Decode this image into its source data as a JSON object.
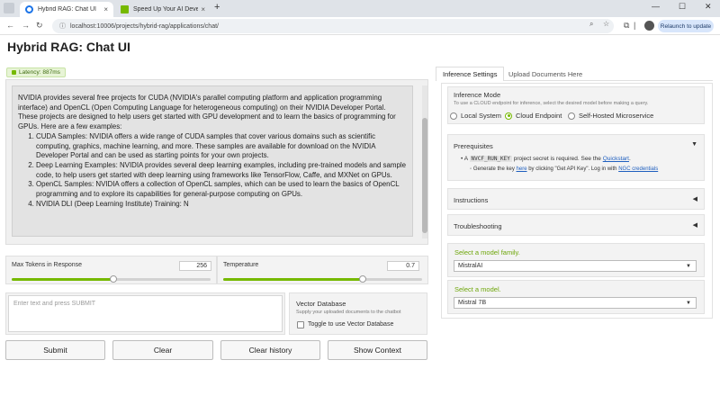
{
  "browser": {
    "tabs": [
      {
        "title": "Hybrid RAG: Chat UI",
        "close": "×"
      },
      {
        "title": "Speed Up Your AI Development",
        "close": "×"
      }
    ],
    "new_tab": "+",
    "window_controls": {
      "minimize": "—",
      "maximize": "☐",
      "close": "✕"
    },
    "url": "localhost:10006/projects/hybrid-rag/applications/chat/",
    "relaunch_label": "Relaunch to update"
  },
  "app": {
    "title": "Hybrid RAG: Chat UI",
    "latency": "Latency: 887ms",
    "chat": {
      "intro": "NVIDIA provides several free projects for CUDA (NVIDIA's parallel computing platform and application programming interface) and OpenCL (Open Computing Language for heterogeneous computing) on their NVIDIA Developer Portal. These projects are designed to help users get started with GPU development and to learn the basics of programming for GPUs. Here are a few examples:",
      "items": [
        "CUDA Samples: NVIDIA offers a wide range of CUDA samples that cover various domains such as scientific computing, graphics, machine learning, and more. These samples are available for download on the NVIDIA Developer Portal and can be used as starting points for your own projects.",
        "Deep Learning Examples: NVIDIA provides several deep learning examples, including pre-trained models and sample code, to help users get started with deep learning using frameworks like TensorFlow, Caffe, and MXNet on GPUs.",
        "OpenCL Samples: NVIDIA offers a collection of OpenCL samples, which can be used to learn the basics of OpenCL programming and to explore its capabilities for general-purpose computing on GPUs.",
        "NVIDIA DLI (Deep Learning Institute) Training: N"
      ]
    },
    "max_tokens": {
      "label": "Max Tokens in Response",
      "value": "256",
      "fraction": 0.51
    },
    "temperature": {
      "label": "Temperature",
      "value": "0.7",
      "fraction": 0.7
    },
    "input_placeholder": "Enter text and press SUBMIT",
    "vector_db": {
      "title": "Vector Database",
      "desc": "Supply your uploaded documents to the chatbot",
      "toggle_label": "Toggle to use Vector Database"
    },
    "buttons": {
      "submit": "Submit",
      "clear": "Clear",
      "clear_history": "Clear history",
      "show_context": "Show Context"
    }
  },
  "settings": {
    "tabs": [
      "Inference Settings",
      "Upload Documents Here"
    ],
    "inference_mode": {
      "title": "Inference Mode",
      "desc": "To use a CLOUD endpoint for inference, select the desired model before making a query.",
      "options": [
        "Local System",
        "Cloud Endpoint",
        "Self-Hosted Microservice"
      ],
      "selected": "Cloud Endpoint"
    },
    "prerequisites": {
      "title": "Prerequisites",
      "line1_pre": "A",
      "line1_code": "NVCF_RUN_KEY",
      "line1_mid": "project secret is required. See the",
      "line1_link": "Quickstart",
      "line1_post": ".",
      "line2_pre": "Generate the key",
      "line2_link1": "here",
      "line2_mid": "by clicking \"Get API Key\". Log in with",
      "line2_link2": "NGC credentials",
      "bullet": "•",
      "bullet2": "◦",
      "arrow": "▼"
    },
    "instructions": {
      "title": "Instructions",
      "arrow": "◀"
    },
    "troubleshooting": {
      "title": "Troubleshooting",
      "arrow": "◀"
    },
    "model_family": {
      "label": "Select a model family.",
      "value": "MistralAI"
    },
    "model": {
      "label": "Select a model.",
      "value": "Mistral 7B"
    },
    "caret": "▼"
  },
  "icons": {
    "back": "back-arrow-icon",
    "forward": "forward-arrow-icon",
    "reload": "reload-icon",
    "zoom": "zoom-icon",
    "bookmark": "bookmark-star-icon",
    "extensions": "extensions-icon",
    "menu": "menu-icon"
  },
  "colors": {
    "accent": "#76b900",
    "link": "#1f5fbf"
  }
}
